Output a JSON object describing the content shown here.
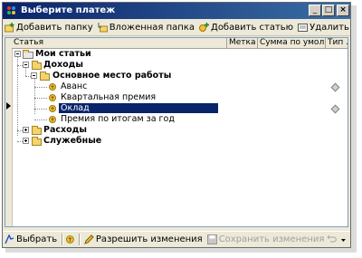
{
  "window": {
    "title": "Выберите платеж"
  },
  "title_buttons": {
    "minimize": "_",
    "maximize": "□",
    "close": "×"
  },
  "toolbar": {
    "add_folder": "Добавить папку",
    "nested_folder": "Вложенная папка",
    "add_item": "Добавить статью",
    "delete": "Удалить"
  },
  "columns": [
    "Статья",
    "Метка",
    "Сумма по умол...",
    "Тип ..."
  ],
  "tree": {
    "root": "Мои статьи",
    "income": "Доходы",
    "main_job": "Основное место работы",
    "item_advance": "Аванс",
    "item_quarterly": "Квартальная премия",
    "item_salary": "Оклад",
    "item_annual": "Премия по итогам за год",
    "expenses": "Расходы",
    "service": "Служебные"
  },
  "bottom": {
    "select": "Выбрать",
    "allow_changes": "Разрешить изменения",
    "save_changes": "Сохранить изменения"
  },
  "colors": {
    "title_start": "#0a246a",
    "title_end": "#3a6ea5",
    "selection": "#0a246a",
    "folder": "#f3d36a"
  }
}
